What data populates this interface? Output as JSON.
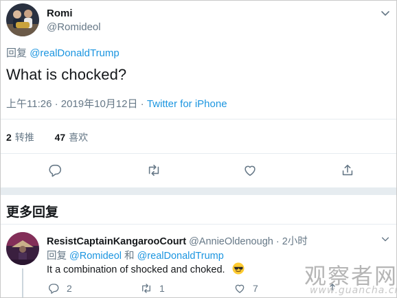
{
  "tweet": {
    "display_name": "Romi",
    "handle": "@Romideol",
    "reply_prefix": "回复",
    "reply_mention": "@realDonaldTrump",
    "text": "What is chocked?",
    "timestamp": "上午11:26 · 2019年10月12日 · ",
    "source": "Twitter for iPhone",
    "retweet_count": "2",
    "retweet_label": "转推",
    "like_count": "47",
    "like_label": "喜欢"
  },
  "section": {
    "more_replies": "更多回复"
  },
  "reply": {
    "display_name": "ResistCaptainKangarooCourt",
    "handle_time": "@AnnieOldenough · 2小时",
    "reply_prefix": "回复",
    "mention_1": "@Romideol",
    "conjunction": "和",
    "mention_2": "@realDonaldTrump",
    "text": "It a combination of shocked and choked.",
    "reply_count": "2",
    "retweet_count": "1",
    "like_count": "7"
  },
  "watermark": {
    "site_name": "观察者网",
    "site_url": "www.guancha.cn"
  },
  "icons": {
    "reply": "reply-icon",
    "retweet": "retweet-icon",
    "like": "heart-icon",
    "share": "share-icon",
    "more": "chevron-down-icon",
    "emoji": "sunglasses-emoji"
  },
  "colors": {
    "link": "#1b95e0",
    "secondary_text": "#657786",
    "divider": "#e6ecf0"
  }
}
